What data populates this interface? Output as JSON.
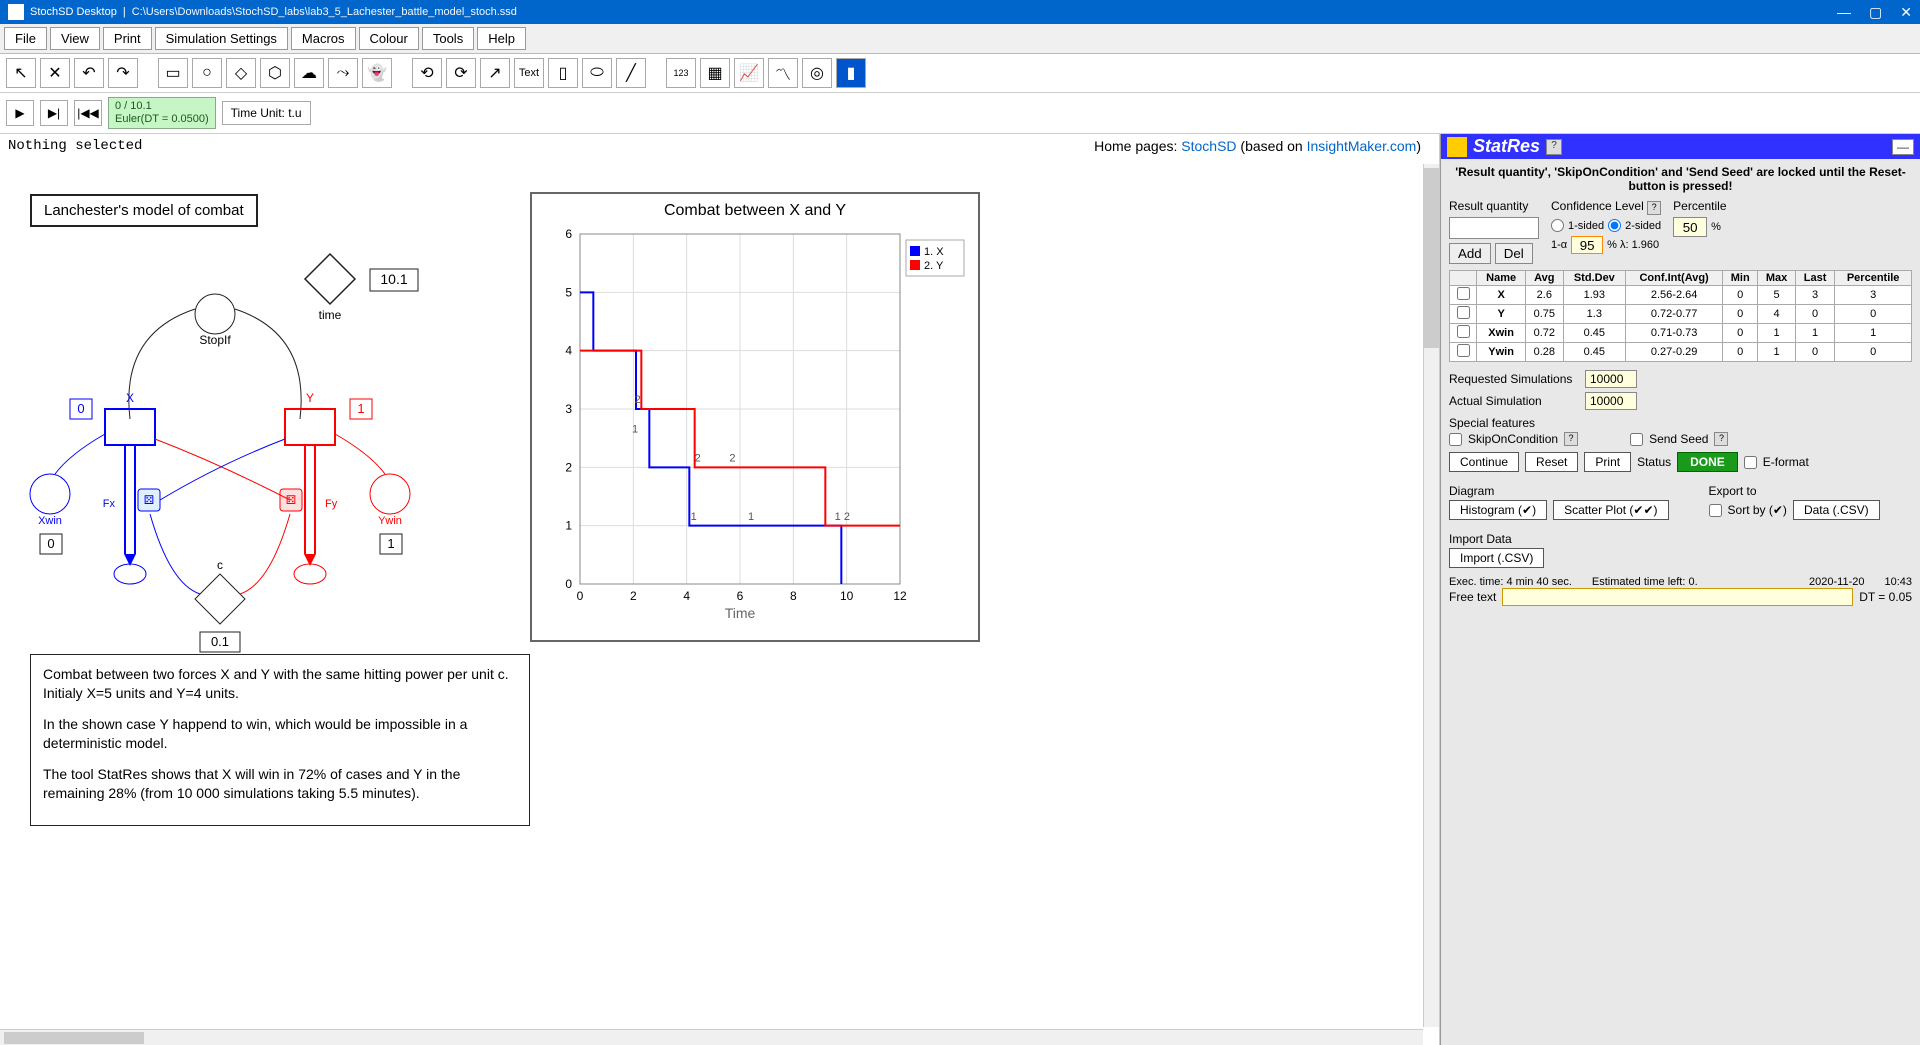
{
  "window": {
    "app": "StochSD Desktop",
    "path": "C:\\Users\\Downloads\\StochSD_labs\\lab3_5_Lachester_battle_model_stoch.ssd"
  },
  "menu": [
    "File",
    "View",
    "Print",
    "Simulation Settings",
    "Macros",
    "Colour",
    "Tools",
    "Help"
  ],
  "sim": {
    "progress": "0 / 10.1",
    "method": "Euler(DT = 0.0500)",
    "time_unit": "Time Unit: t.u"
  },
  "status": "Nothing selected",
  "home": {
    "prefix": "Home pages: ",
    "link1": "StochSD",
    "mid": " (based on ",
    "link2": "InsightMaker.com",
    "suffix": ")"
  },
  "model": {
    "title": "Lanchester's model of combat",
    "time_val": "10.1",
    "time_label": "time",
    "stopif": "StopIf",
    "x": {
      "label": "X",
      "badge": "0",
      "fx": "Fx"
    },
    "y": {
      "label": "Y",
      "badge": "1",
      "fy": "Fy"
    },
    "xwin": {
      "label": "Xwin",
      "val": "0"
    },
    "ywin": {
      "label": "Ywin",
      "val": "1"
    },
    "c": {
      "label": "c",
      "val": "0.1"
    }
  },
  "desc": {
    "p1": "Combat between two forces X and Y with the same hitting power per unit c. Initialy X=5 units and Y=4 units.",
    "p2": "In the shown case Y happend to win, which would be impossible in a deterministic model.",
    "p3": "The tool StatRes shows that X will win in 72% of cases and Y in the remaining 28% (from 10 000 simulations taking 5.5 minutes)."
  },
  "chart_data": {
    "type": "line",
    "title": "Combat between X and Y",
    "xlabel": "Time",
    "ylabel": "",
    "xlim": [
      0,
      12
    ],
    "ylim": [
      0,
      6
    ],
    "xticks": [
      0,
      2,
      4,
      6,
      8,
      10,
      12
    ],
    "yticks": [
      0,
      1,
      2,
      3,
      4,
      5,
      6
    ],
    "legend": [
      "1. X",
      "2. Y"
    ],
    "series": [
      {
        "name": "X",
        "color": "#0000ff",
        "step": [
          [
            0,
            5
          ],
          [
            0.5,
            5
          ],
          [
            0.5,
            4
          ],
          [
            2.1,
            4
          ],
          [
            2.1,
            3
          ],
          [
            2.6,
            3
          ],
          [
            2.6,
            2
          ],
          [
            4.1,
            2
          ],
          [
            4.1,
            1
          ],
          [
            9.8,
            1
          ],
          [
            9.8,
            0
          ]
        ]
      },
      {
        "name": "Y",
        "color": "#ff0000",
        "step": [
          [
            0,
            4
          ],
          [
            2.3,
            4
          ],
          [
            2.3,
            3
          ],
          [
            4.3,
            3
          ],
          [
            4.3,
            2
          ],
          [
            9.2,
            2
          ],
          [
            9.2,
            1
          ],
          [
            12,
            1
          ]
        ]
      }
    ],
    "annotations": [
      {
        "x": 2.05,
        "y": 3.1,
        "t": "2"
      },
      {
        "x": 1.95,
        "y": 2.6,
        "t": "1"
      },
      {
        "x": 4.3,
        "y": 2.1,
        "t": "2"
      },
      {
        "x": 5.6,
        "y": 2.1,
        "t": "2"
      },
      {
        "x": 4.15,
        "y": 1.1,
        "t": "1"
      },
      {
        "x": 6.3,
        "y": 1.1,
        "t": "1"
      },
      {
        "x": 9.55,
        "y": 1.1,
        "t": "1 2"
      }
    ]
  },
  "statres": {
    "title": "StatRes",
    "lock_msg": "'Result quantity', 'SkipOnCondition' and 'Send Seed' are locked until the Reset-button is pressed!",
    "labels": {
      "rq": "Result quantity",
      "cl": "Confidence Level",
      "pct": "Percentile",
      "oneside": "1-sided",
      "twoside": "2-sided",
      "onealpha": "1-α",
      "pct_lambda": "% λ: 1.960",
      "add": "Add",
      "del": "Del"
    },
    "conf_val": "95",
    "pct_val": "50",
    "cols": [
      "Name",
      "Avg",
      "Std.Dev",
      "Conf.Int(Avg)",
      "Min",
      "Max",
      "Last",
      "Percentile"
    ],
    "rows": [
      {
        "name": "X",
        "avg": "2.6",
        "sd": "1.93",
        "ci": "2.56-2.64",
        "min": "0",
        "max": "5",
        "last": "3",
        "pct": "3"
      },
      {
        "name": "Y",
        "avg": "0.75",
        "sd": "1.3",
        "ci": "0.72-0.77",
        "min": "0",
        "max": "4",
        "last": "0",
        "pct": "0"
      },
      {
        "name": "Xwin",
        "avg": "0.72",
        "sd": "0.45",
        "ci": "0.71-0.73",
        "min": "0",
        "max": "1",
        "last": "1",
        "pct": "1"
      },
      {
        "name": "Ywin",
        "avg": "0.28",
        "sd": "0.45",
        "ci": "0.27-0.29",
        "min": "0",
        "max": "1",
        "last": "0",
        "pct": "0"
      }
    ],
    "req_sim_l": "Requested Simulations",
    "req_sim": "10000",
    "act_sim_l": "Actual Simulation",
    "act_sim": "10000",
    "special": "Special features",
    "skip": "SkipOnCondition",
    "seed": "Send Seed",
    "btns": {
      "cont": "Continue",
      "reset": "Reset",
      "print": "Print",
      "status_l": "Status",
      "done": "DONE",
      "efmt": "E-format",
      "diag": "Diagram",
      "export": "Export to",
      "hist": "Histogram (✔)",
      "scatter": "Scatter Plot (✔✔)",
      "sort": "Sort by (✔)",
      "csv": "Data (.CSV)",
      "import_l": "Import Data",
      "import": "Import (.CSV)"
    },
    "exec": {
      "time": "Exec. time: 4 min 40 sec.",
      "est": "Estimated time left: 0.",
      "date": "2020-11-20",
      "clock": "10:43",
      "free": "Free text",
      "dt": "DT = 0.05"
    }
  }
}
